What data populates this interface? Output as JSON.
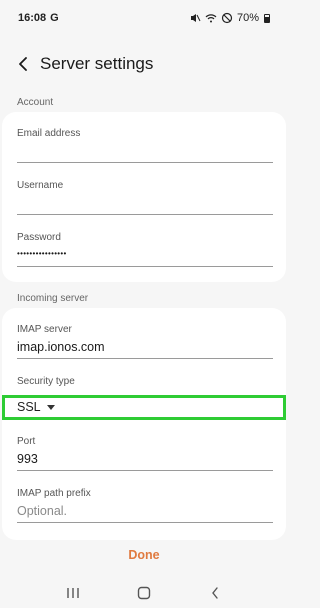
{
  "status_bar": {
    "time": "16:08",
    "carrier_icon": "G",
    "battery": "70%",
    "icons": [
      "mute-icon",
      "wifi-icon",
      "do-not-disturb-icon",
      "battery-icon"
    ]
  },
  "header": {
    "title": "Server settings",
    "back_icon": "chevron-left-icon"
  },
  "account": {
    "section_label": "Account",
    "email": {
      "label": "Email address",
      "value": ""
    },
    "username": {
      "label": "Username",
      "value": ""
    },
    "password": {
      "label": "Password",
      "value": "••••••••••••••••"
    }
  },
  "incoming": {
    "section_label": "Incoming server",
    "imap_server": {
      "label": "IMAP server",
      "value": "imap.ionos.com"
    },
    "security_type": {
      "label": "Security type",
      "value": "SSL"
    },
    "port": {
      "label": "Port",
      "value": "993"
    },
    "imap_prefix": {
      "label": "IMAP path prefix",
      "placeholder": "Optional."
    }
  },
  "footer": {
    "done_label": "Done"
  },
  "colors": {
    "accent": "#e07a3f",
    "highlight": "#2ecc34"
  },
  "nav_bar": [
    "recent-apps-icon",
    "home-icon",
    "back-icon"
  ]
}
